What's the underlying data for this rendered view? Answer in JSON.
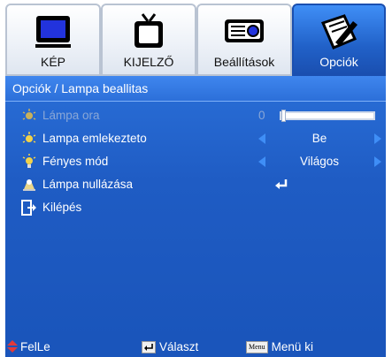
{
  "tabs": [
    {
      "label": "KÉP",
      "icon": "monitor-icon"
    },
    {
      "label": "KIJELZŐ",
      "icon": "tv-icon"
    },
    {
      "label": "Beállítások",
      "icon": "projector-icon"
    },
    {
      "label": "Opciók",
      "icon": "pencil-paper-icon",
      "active": true
    }
  ],
  "breadcrumb": "Opciók / Lampa beallitas",
  "rows": [
    {
      "label": "Lámpa ora",
      "icon": "lamp-icon",
      "disabled": true,
      "value": "0",
      "slider_value": 0
    },
    {
      "label": "Lampa emlekezteto",
      "icon": "lamp-icon",
      "value": "Be"
    },
    {
      "label": "Fényes mód",
      "icon": "bulb-icon",
      "value": "Világos"
    },
    {
      "label": "Lámpa nullázása",
      "icon": "lamp-reset-icon",
      "value": "↵"
    },
    {
      "label": "Kilépés",
      "icon": "exit-icon"
    }
  ],
  "footer": {
    "nav_label": "FelLe",
    "select_label": "Választ",
    "menu_key": "Menu",
    "menu_label": "Menü ki"
  },
  "colors": {
    "accent": "#2161c8",
    "panel": "#1f5cc4",
    "arrow": "#3f8ef6"
  }
}
